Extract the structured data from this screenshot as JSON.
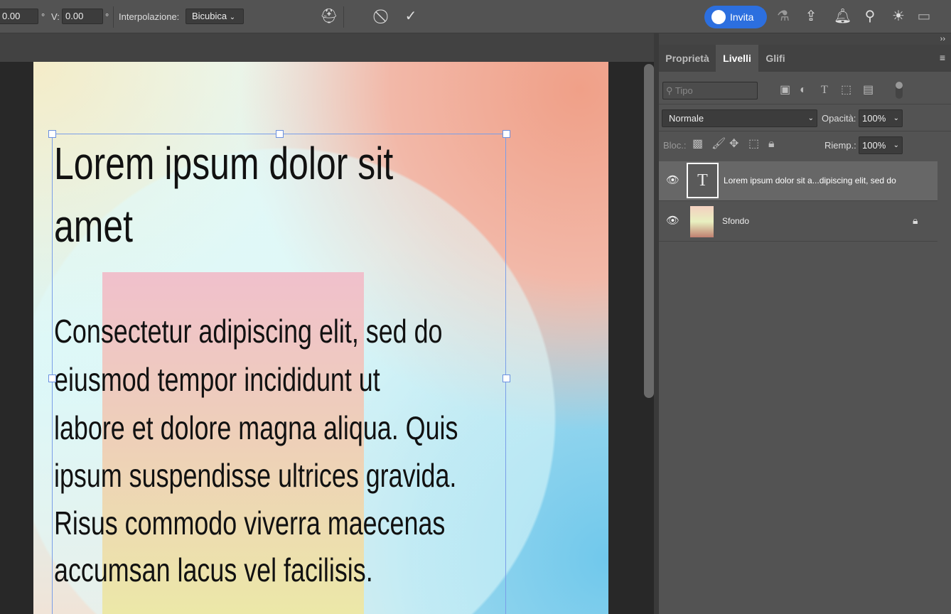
{
  "toolbar": {
    "h_value": "0.00",
    "h_unit": "°",
    "v_label": "V:",
    "v_value": "0.00",
    "v_unit": "°",
    "interp_label": "Interpolazione:",
    "interp_value": "Bicubica",
    "invite_label": "Invita"
  },
  "panel": {
    "collapse": "››",
    "tabs": [
      "Proprietà",
      "Livelli",
      "Glifi"
    ],
    "filter_placeholder": "Tipo",
    "blend_mode": "Normale",
    "opacity_label": "Opacità:",
    "opacity_value": "100%",
    "lock_label": "Bloc.:",
    "fill_label": "Riemp.:",
    "fill_value": "100%",
    "layers": [
      {
        "name": "Lorem ipsum dolor sit a...dipiscing elit, sed do",
        "type": "text",
        "thumb": "T",
        "visible": true,
        "selected": true
      },
      {
        "name": "Sfondo",
        "type": "image",
        "visible": true,
        "locked": true
      }
    ]
  },
  "canvas": {
    "title_lines": [
      "Lorem ipsum dolor sit",
      "amet"
    ],
    "body_lines": [
      "Consectetur adipiscing elit, sed do",
      "eiusmod tempor incididunt ut",
      "labore et dolore magna aliqua. Quis",
      "ipsum suspendisse ultrices gravida.",
      "Risus commodo viverra maecenas",
      "accumsan lacus vel facilisis."
    ]
  }
}
